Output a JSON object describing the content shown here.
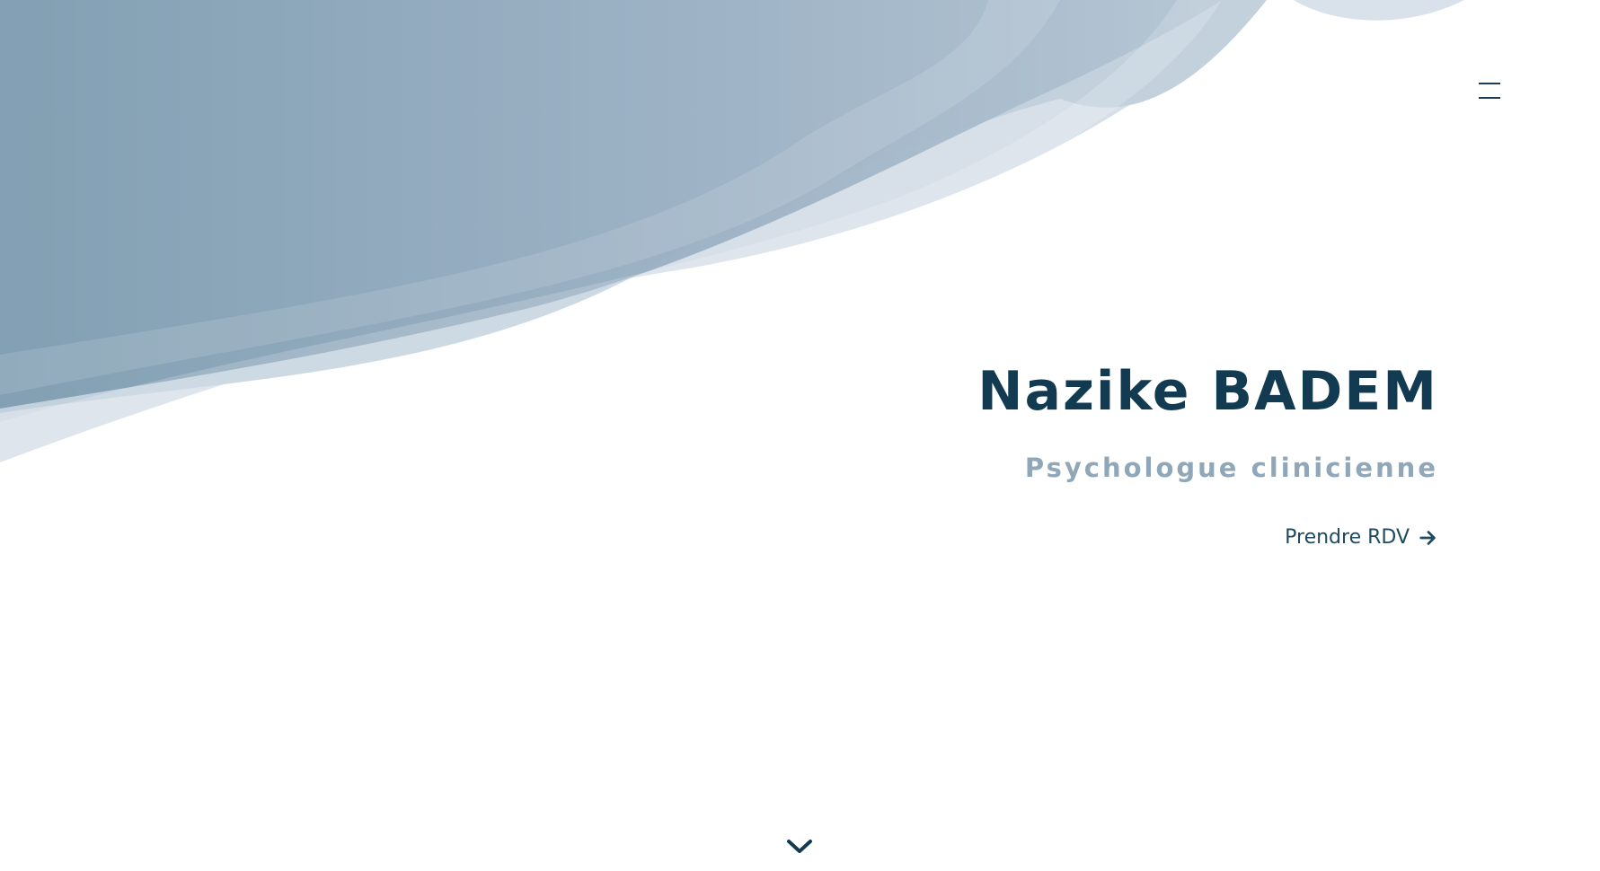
{
  "header": {
    "menu_icon": "hamburger-menu-icon"
  },
  "hero": {
    "title": "Nazike BADEM",
    "subtitle": "Psychologue clinicienne",
    "cta_label": "Prendre RDV",
    "cta_icon": "arrow-right-icon"
  },
  "footer": {
    "scroll_icon": "chevron-down-icon"
  },
  "colors": {
    "primary": "#123b52",
    "subtitle": "#8fa7b8",
    "wave": "#7d9bb0",
    "background": "#ffffff"
  }
}
